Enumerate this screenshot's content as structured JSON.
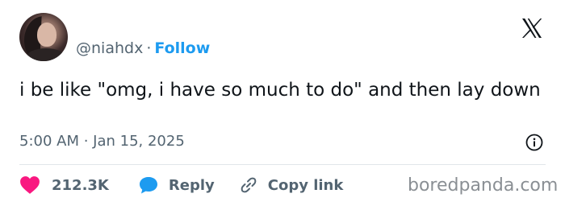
{
  "author": {
    "handle": "@niahdx",
    "separator": "·",
    "follow_label": "Follow"
  },
  "tweet": {
    "text": "i be like \"omg, i have so much to do\" and then lay down",
    "timestamp": "5:00 AM · Jan 15, 2025"
  },
  "actions": {
    "like_count": "212.3K",
    "reply_label": "Reply",
    "copy_link_label": "Copy link"
  },
  "watermark": "boredpanda.com",
  "colors": {
    "accent": "#1d9bf0",
    "like": "#f91880",
    "text": "#0f1419",
    "muted": "#536471"
  },
  "icons": [
    "x-logo-icon",
    "info-icon",
    "heart-icon",
    "reply-bubble-icon",
    "link-icon"
  ]
}
